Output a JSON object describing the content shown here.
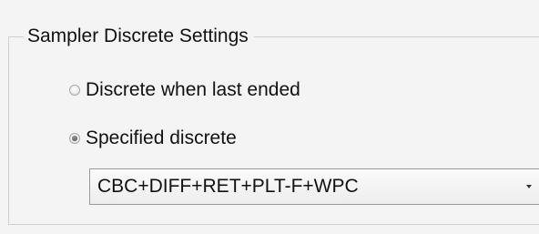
{
  "settings_group": {
    "title": "Sampler Discrete Settings",
    "options": [
      {
        "label": "Discrete when last ended",
        "selected": false
      },
      {
        "label": "Specified discrete",
        "selected": true
      }
    ],
    "discrete_select": {
      "value": "CBC+DIFF+RET+PLT-F+WPC",
      "icon": "chevron-down-icon"
    }
  }
}
